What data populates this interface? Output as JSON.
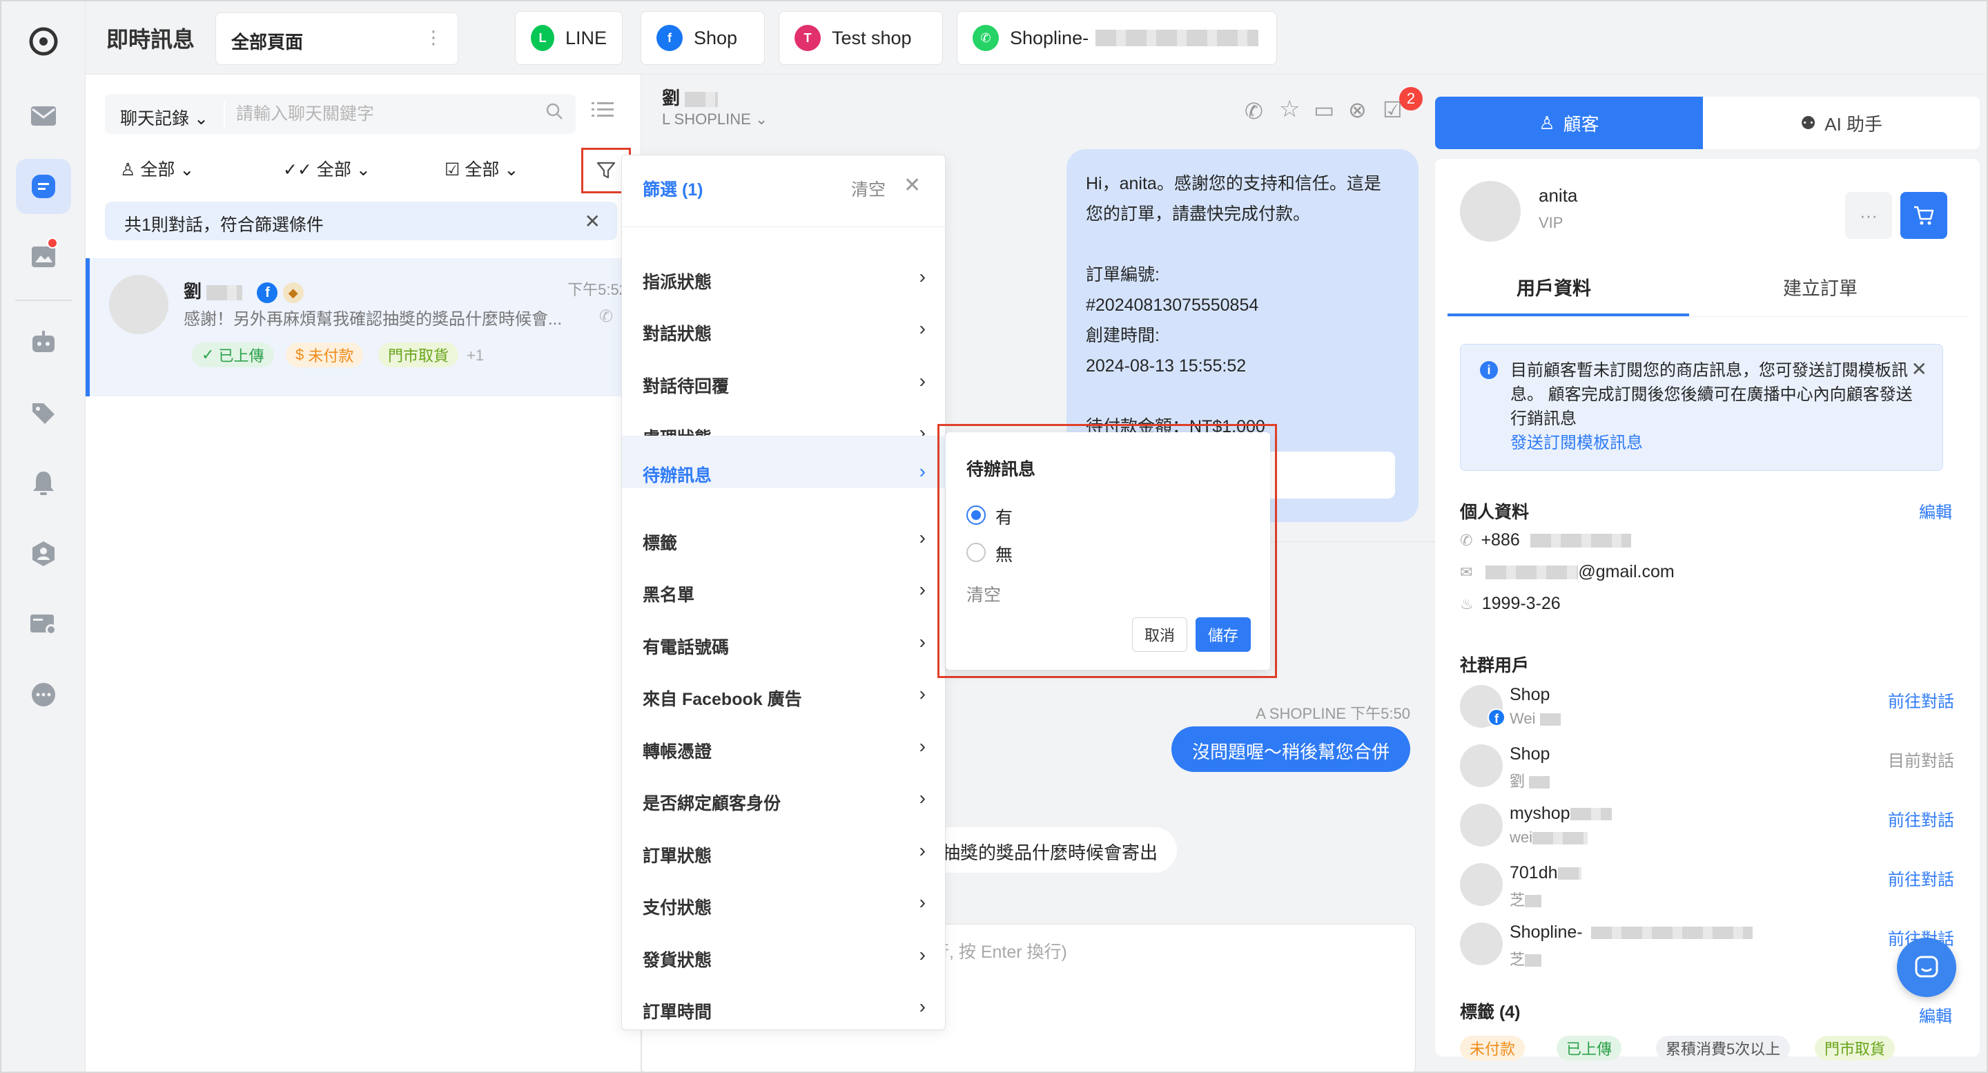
{
  "app": {
    "title": "即時訊息",
    "page_select": "全部頁面"
  },
  "channels": [
    {
      "label": "LINE",
      "icon": "line-icon",
      "color": "#06c755"
    },
    {
      "label": "Shop",
      "icon": "shop-multi-icon",
      "color": "#1877f2"
    },
    {
      "label": "Test shop",
      "icon": "facebook-instagram-icon",
      "color": "#e1306c"
    },
    {
      "label": "Shopline-",
      "icon": "whatsapp-icon",
      "color": "#25d366"
    }
  ],
  "list": {
    "search_mode": "聊天記錄",
    "search_placeholder": "請輸入聊天關鍵字",
    "filters": [
      "全部",
      "全部",
      "全部"
    ],
    "match_text": "共1則對話，符合篩選條件",
    "conversation": {
      "name": "劉",
      "time": "下午5:52",
      "preview": "感謝！另外再麻煩幫我確認抽獎的獎品什麼時候會...",
      "tags": [
        "已上傳",
        "未付款",
        "門市取貨"
      ],
      "more_tags": "+1"
    }
  },
  "chat": {
    "contact_name": "劉",
    "contact_channel": "L SHOPLINE",
    "notification_count": "2",
    "incoming_lines": [
      "Hi，anita。感謝您的支持和信任。這是",
      "您的訂單，請盡快完成付款。",
      "",
      "訂單編號:",
      "#20240813075550854",
      "創建時間:",
      "2024-08-13 15:55:52",
      "",
      "待付款金額：NT$1,000"
    ],
    "outgoing_meta": "A SHOPLINE 下午5:50",
    "outgoing_text": "沒問題喔～稍後幫您合併",
    "incoming_text": "抽獎的獎品什麼時候會寄出",
    "input_placeholder": "行, 按 Enter 換行)"
  },
  "filter_menu": {
    "title": "篩選 (1)",
    "clear": "清空",
    "items": [
      "指派狀態",
      "對話狀態",
      "對話待回覆",
      "處理狀態",
      "待辦訊息",
      "標籤",
      "黑名單",
      "有電話號碼",
      "來自 Facebook 廣告",
      "轉帳憑證",
      "是否綁定顧客身份",
      "訂單狀態",
      "支付狀態",
      "發貨狀態",
      "訂單時間"
    ],
    "active_item": "待辦訊息"
  },
  "pending_popover": {
    "title": "待辦訊息",
    "options": [
      "有",
      "無"
    ],
    "selected": "有",
    "clear": "清空",
    "cancel": "取消",
    "save": "儲存"
  },
  "customer": {
    "tabs": [
      "顧客",
      "AI 助手"
    ],
    "name": "anita",
    "level": "VIP",
    "subtabs": [
      "用戶資料",
      "建立訂單"
    ],
    "notice_text": "目前顧客暫未訂閱您的商店訊息，您可發送訂閱模板訊息。 顧客完成訂閱後您後續可在廣播中心內向顧客發送行銷訊息",
    "notice_link": "發送訂閱模板訊息",
    "personal_title": "個人資料",
    "edit": "編輯",
    "phone_prefix": "+886",
    "email_suffix": "@gmail.com",
    "birthday": "1999-3-26",
    "social_title": "社群用戶",
    "social": [
      {
        "name": "Shop",
        "sub": "Wei",
        "action": "前往對話"
      },
      {
        "name": "Shop",
        "sub": "劉",
        "action": "目前對話"
      },
      {
        "name": "myshop",
        "sub": "wei",
        "action": "前往對話"
      },
      {
        "name": "701dh",
        "sub": "芝",
        "action": "前往對話"
      },
      {
        "name": "Shopline-",
        "sub": "芝",
        "action": "前往對話"
      }
    ],
    "tags_title": "標籤 (4)",
    "tags": [
      "未付款",
      "已上傳",
      "累積消費5次以上",
      "門市取貨"
    ]
  }
}
